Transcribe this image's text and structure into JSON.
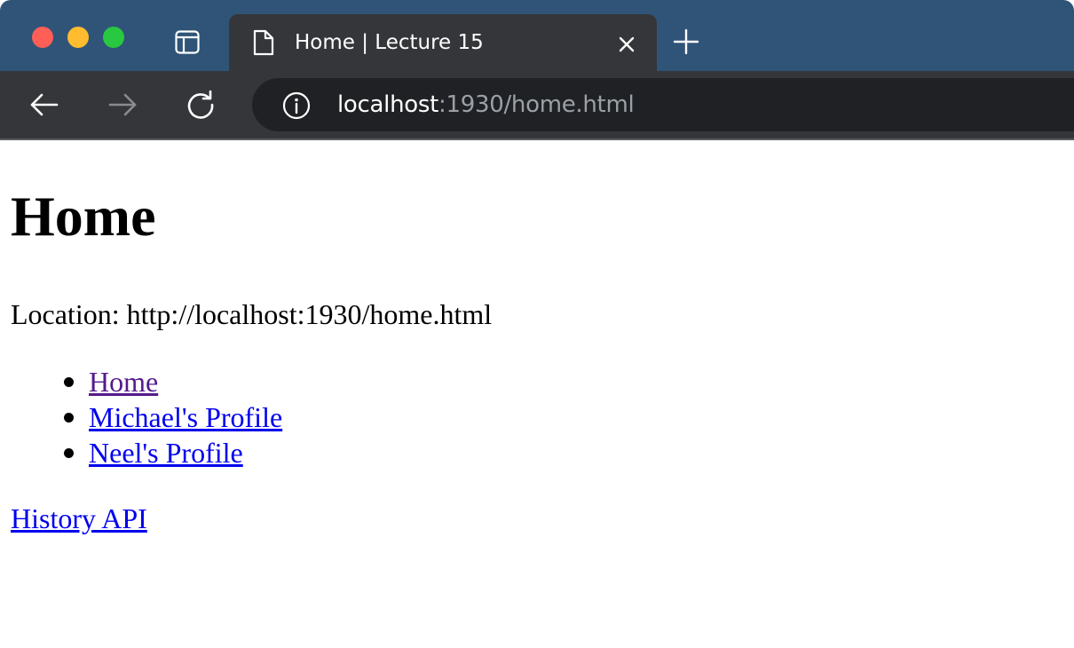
{
  "browser": {
    "tab": {
      "title": "Home | Lecture 15"
    },
    "address": {
      "host": "localhost",
      "rest": ":1930/home.html"
    },
    "icons": [
      "close-window",
      "minimize-window",
      "maximize-window",
      "sidebar-icon",
      "document-icon",
      "close-tab-icon",
      "new-tab-icon",
      "back-arrow-icon",
      "forward-arrow-icon",
      "reload-icon",
      "info-icon"
    ]
  },
  "page": {
    "heading": "Home",
    "location": "Location: http://localhost:1930/home.html",
    "links": [
      {
        "label": "Home",
        "visited": true
      },
      {
        "label": "Michael's Profile",
        "visited": false
      },
      {
        "label": "Neel's Profile",
        "visited": false
      }
    ],
    "history_link": "History API"
  },
  "colors": {
    "tabbar": "#2f5478",
    "toolbar": "#35363a",
    "omnibox": "#202124",
    "link": "#0000ee",
    "visited_link": "#551a8b"
  }
}
